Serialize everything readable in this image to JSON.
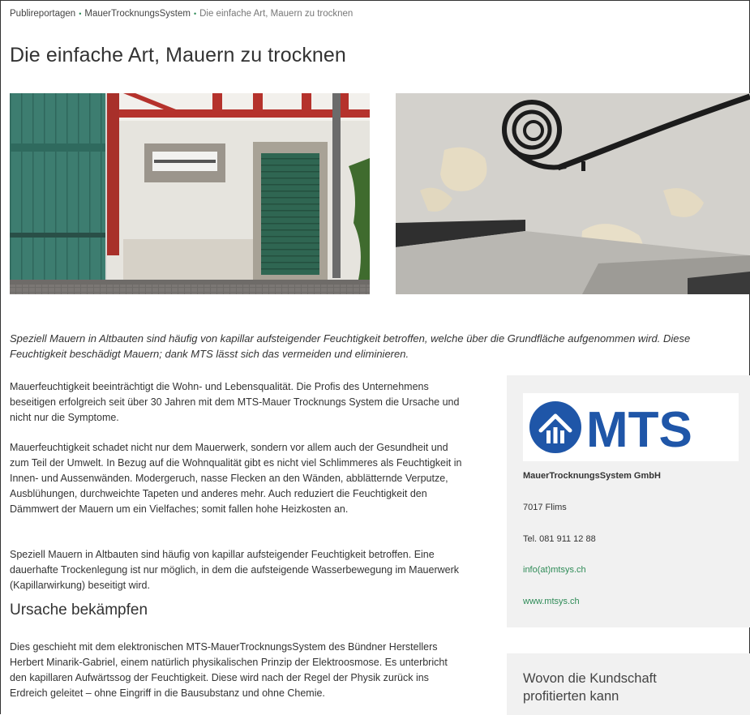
{
  "breadcrumb": {
    "items": [
      "Publireportagen",
      "MauerTrocknungsSystem"
    ],
    "current": "Die einfache Art, Mauern zu trocknen"
  },
  "article": {
    "title": "Die einfache Art, Mauern zu trocknen",
    "lead": "Speziell Mauern in Altbauten sind häufig von kapillar aufsteigender Feuchtigkeit betroffen, welche über die Grundfläche aufgenommen wird. Diese Feuchtigkeit beschädigt Mauern; dank MTS lässt sich das vermeiden und eliminieren.",
    "paragraphs": [
      "Mauerfeuchtigkeit beeinträchtigt die Wohn- und Lebensqualität. Die Profis des Unternehmens beseitigen erfolgreich seit über 30 Jahren mit dem MTS-Mauer Trocknungs System die Ursache und nicht nur die Symptome.",
      "Mauerfeuchtigkeit schadet nicht nur dem Mauerwerk, sondern vor allem auch der Gesundheit und zum Teil der Umwelt. In Bezug auf die Wohnqualität gibt es nicht viel Schlimmeres als Feuchtigkeit in Innen- und Aussenwänden. Modergeruch, nasse Flecken an den Wänden, abblätternde Verputze, Ausblühungen, durchweichte Tapeten und anderes mehr. Auch reduziert die Feuchtigkeit den Dämmwert der Mauern um ein Vielfaches; somit fallen hohe Heizkosten an.",
      "Speziell Mauern in Altbauten sind häufig von kapillar aufsteigender Feuchtigkeit betroffen. Eine dauerhafte Trockenlegung ist nur möglich, in dem die aufsteigende Wasserbewegung im Mauerwerk (Kapillarwirkung) beseitigt wird."
    ],
    "subheading": "Ursache bekämpfen",
    "paragraph_after": "Dies geschieht mit dem elektronischen MTS-MauerTrocknungsSystem des Bündner Herstellers Herbert Minarik-Gabriel, einem natürlich physikalischen Prinzip der Elektroosmose. Es unterbricht den kapillaren Aufwärtssog der Feuchtigkeit. Diese wird nach der Regel der Physik zurück ins Erdreich geleitet – ohne Eingriff in die Bausubstanz und ohne Chemie."
  },
  "sidebar": {
    "logo_text": "MTS",
    "company": "MauerTrocknungsSystem GmbH",
    "city": "7017 Flims",
    "phone": "Tel. 081 911 12 88",
    "email": "info(at)mtsys.ch",
    "web": "www.mtsys.ch",
    "card2_title": "Wovon die Kundschaft profitierten kann"
  },
  "colors": {
    "link_green": "#2e8b57",
    "logo_blue": "#1f56a8",
    "sidebar_bg": "#f1f1f1"
  }
}
